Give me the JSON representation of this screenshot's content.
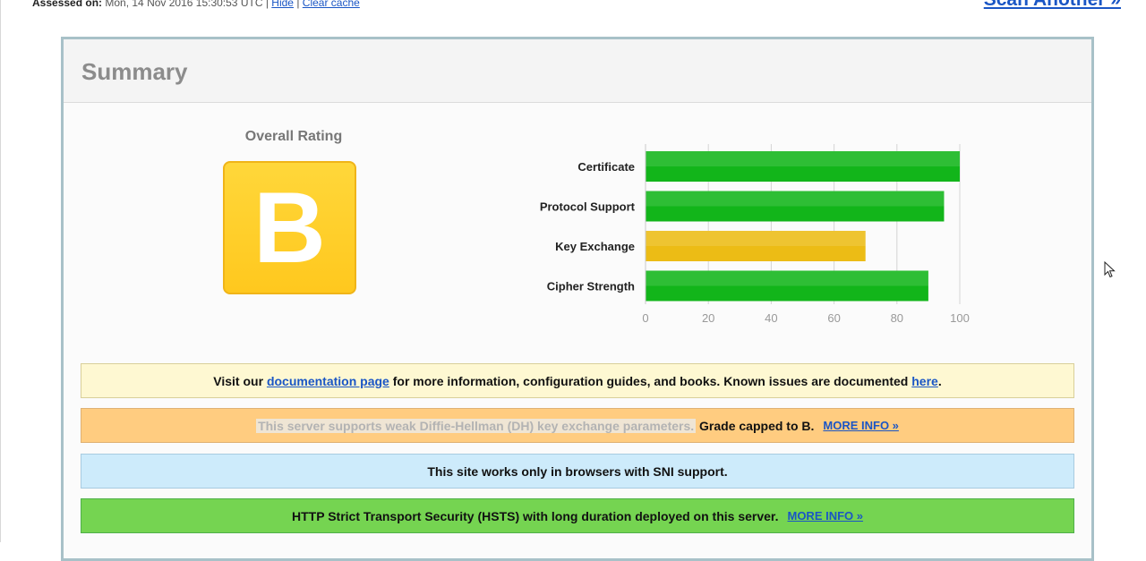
{
  "header": {
    "assessed_label": "Assessed on:",
    "assessed_value": "Mon, 14 Nov 2016 15:30:53 UTC",
    "separator": "|",
    "hide_link": "Hide",
    "clear_cache_link": "Clear cache",
    "scan_another": "Scan Another »"
  },
  "summary": {
    "title": "Summary",
    "overall_label": "Overall Rating",
    "grade": "B",
    "grade_color": "#ffc81e"
  },
  "chart_data": {
    "type": "bar",
    "orientation": "horizontal",
    "categories": [
      "Certificate",
      "Protocol Support",
      "Key Exchange",
      "Cipher Strength"
    ],
    "values": [
      100,
      95,
      70,
      90
    ],
    "bar_colors": [
      "#12b51a",
      "#12b51a",
      "#ecbc15",
      "#12b51a"
    ],
    "xlim": [
      0,
      100
    ],
    "xticks": [
      "0",
      "20",
      "40",
      "60",
      "80",
      "100"
    ],
    "grid": true
  },
  "notices": {
    "doc": {
      "pre": "Visit our",
      "link1": "documentation page",
      "mid": "for more information, configuration guides, and books. Known issues are documented",
      "link2": "here",
      "post": "."
    },
    "dh": {
      "faded_text": "This server supports weak Diffie-Hellman (DH) key exchange parameters.",
      "text": "Grade capped to B.",
      "link": "MORE INFO »"
    },
    "sni": {
      "text": "This site works only in browsers with SNI support."
    },
    "hsts": {
      "text": "HTTP Strict Transport Security (HSTS) with long duration deployed on this server.",
      "link": "MORE INFO »"
    }
  }
}
